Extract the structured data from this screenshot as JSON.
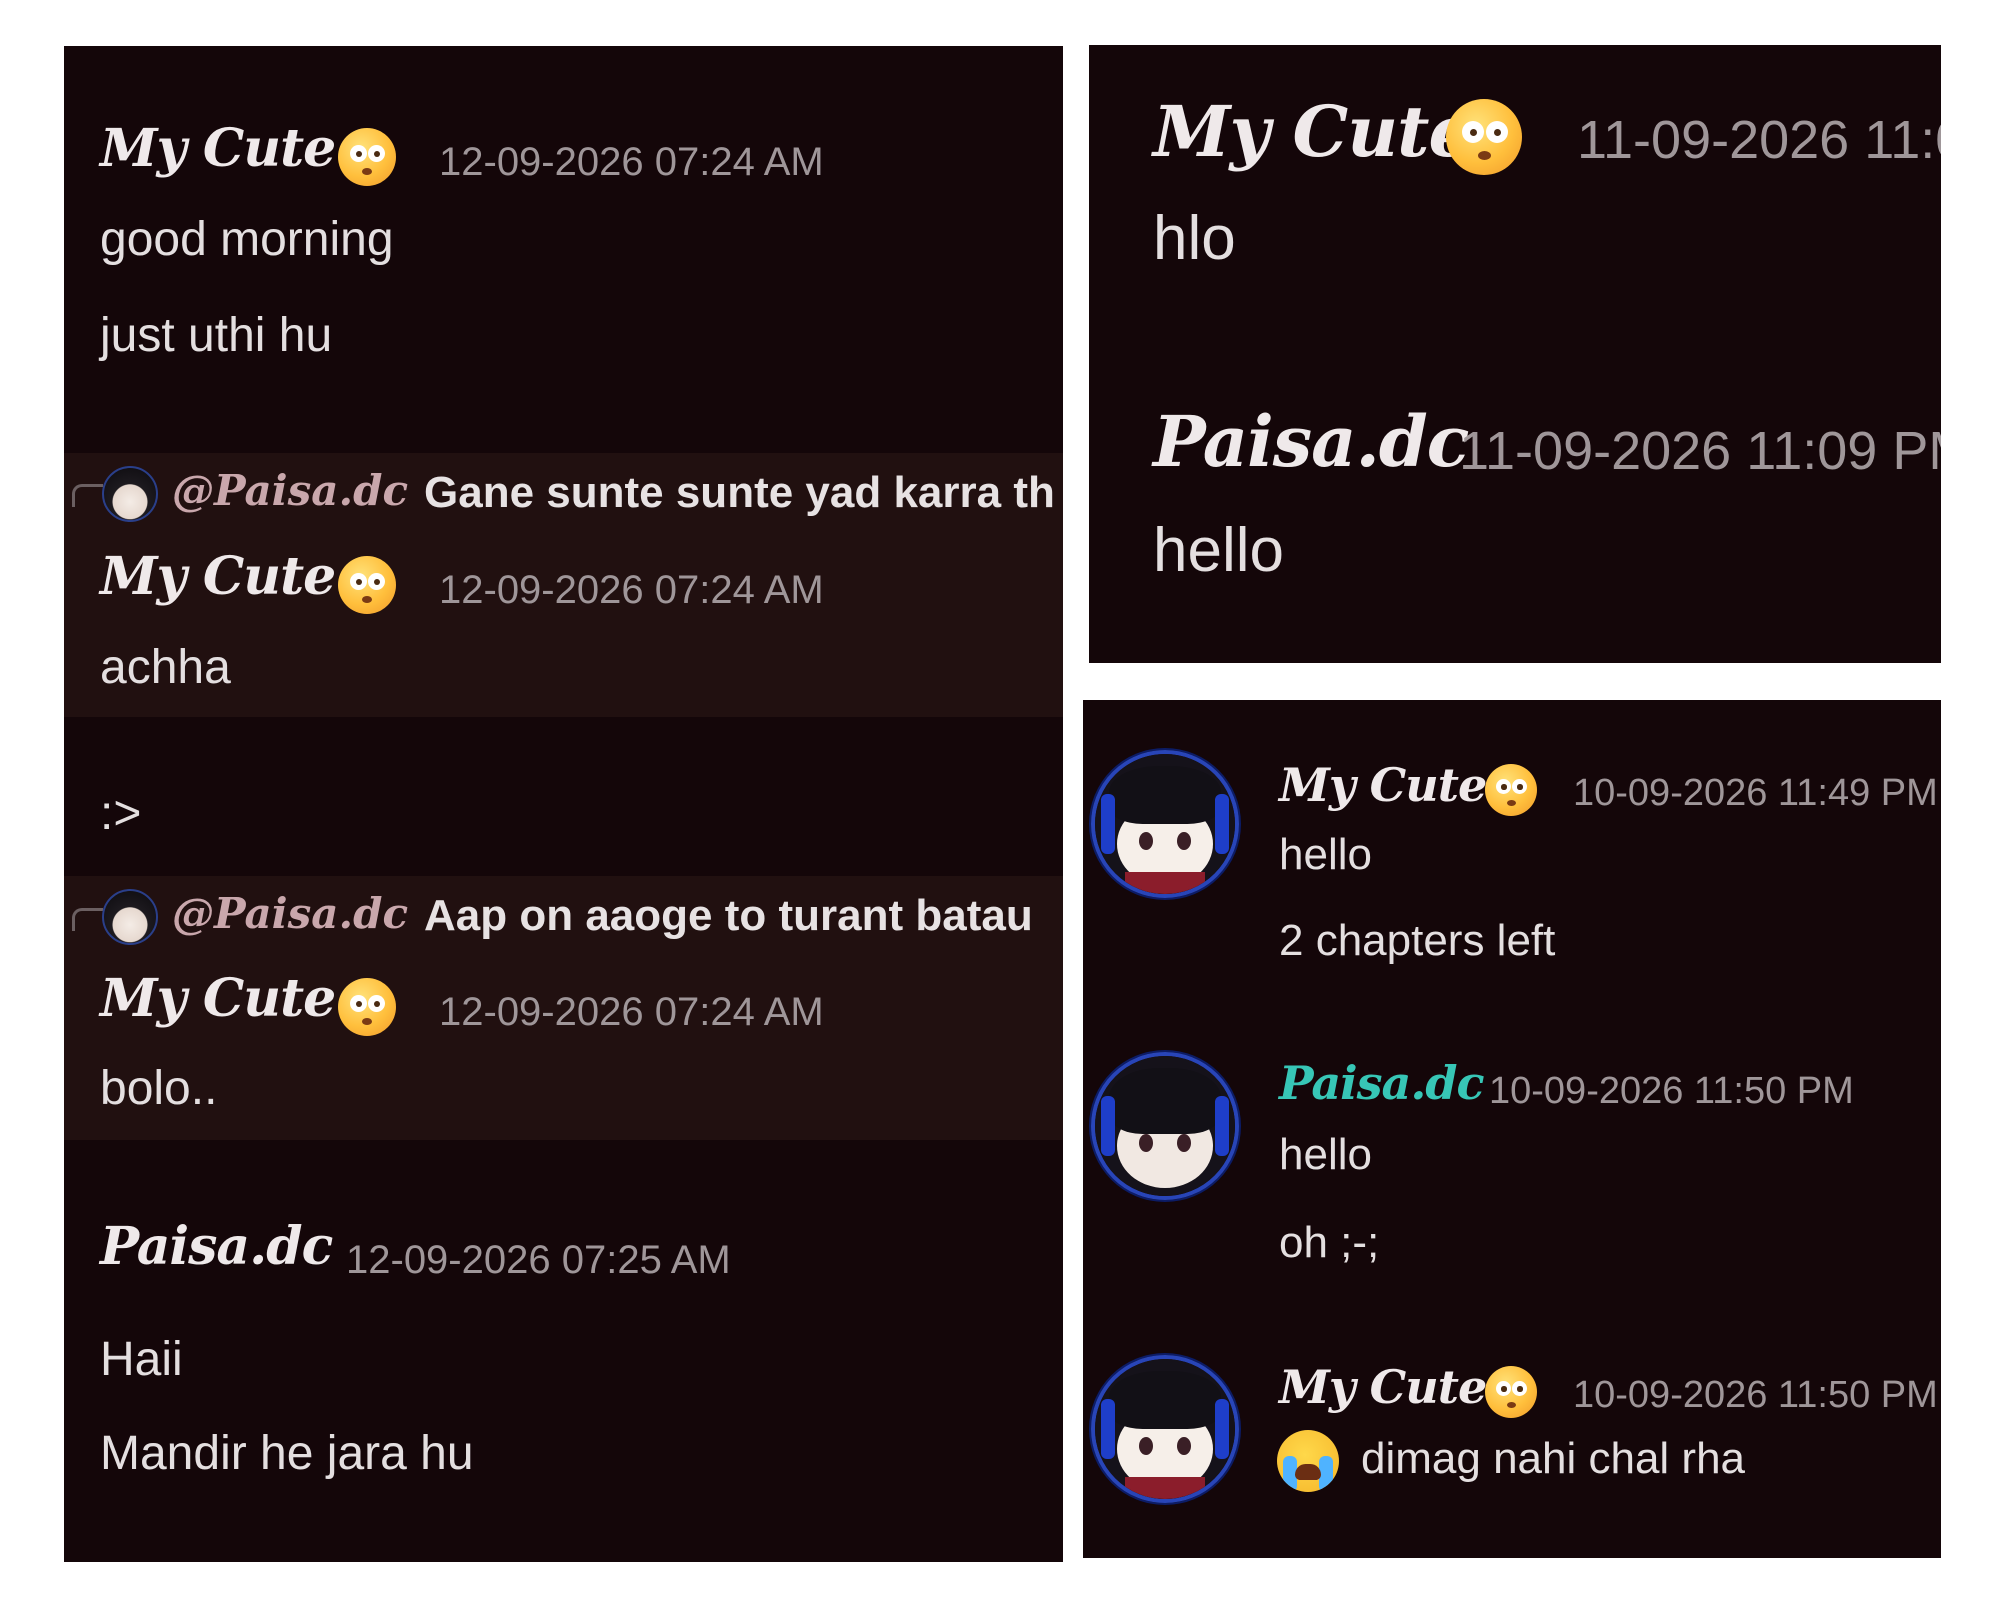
{
  "panels": {
    "left": {
      "messages": [
        {
          "author": "My Cute",
          "timestamp": "12-09-2026 07:24 AM",
          "lines": [
            "good morning",
            "just uthi hu"
          ]
        },
        {
          "reply_to": {
            "mention": "@Paisa.dc",
            "text": "Gane sunte sunte yad karra th"
          },
          "author": "My Cute",
          "timestamp": "12-09-2026 07:24 AM",
          "lines": [
            "achha",
            ":>"
          ]
        },
        {
          "reply_to": {
            "mention": "@Paisa.dc",
            "text": "Aap on aaoge to turant batau"
          },
          "author": "My Cute",
          "timestamp": "12-09-2026 07:24 AM",
          "lines": [
            "bolo.."
          ]
        },
        {
          "author": "Paisa.dc",
          "timestamp": "12-09-2026 07:25 AM",
          "lines": [
            "Haii",
            "Mandir he jara hu"
          ]
        }
      ]
    },
    "top_right": {
      "messages": [
        {
          "author": "My Cute",
          "timestamp": "11-09-2026 11:0",
          "lines": [
            "hlo"
          ]
        },
        {
          "author": "Paisa.dc",
          "timestamp": "11-09-2026 11:09 PM",
          "lines": [
            "hello"
          ]
        }
      ]
    },
    "bottom_right": {
      "messages": [
        {
          "author": "My Cute",
          "timestamp": "10-09-2026 11:49 PM",
          "lines": [
            "hello",
            "2 chapters left"
          ]
        },
        {
          "author": "Paisa.dc",
          "timestamp": "10-09-2026 11:50 PM",
          "lines": [
            "hello",
            "oh ;-;"
          ]
        },
        {
          "author": "My Cute",
          "timestamp": "10-09-2026 11:50 PM",
          "lines": [
            "dimag nahi chal rha"
          ]
        }
      ],
      "author_colors": {
        "my_cute": "#efe9ea",
        "paisa": "#37c6b6"
      }
    }
  },
  "icons": {
    "flushed_emoji": "flushed-face-icon",
    "crying_emoji": "loudly-crying-face-icon"
  },
  "colors": {
    "panel_bg": "#140609",
    "highlight_bg": "#211010",
    "timestamp": "#9f9699"
  }
}
